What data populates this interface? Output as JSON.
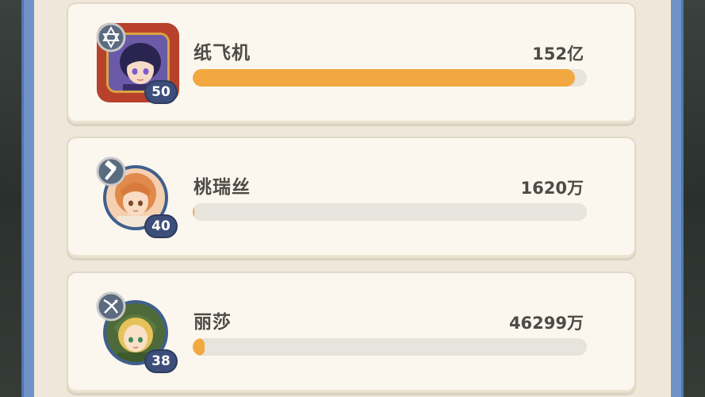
{
  "ranking": [
    {
      "name": "纸飞机",
      "value": "152亿",
      "level": "50",
      "progress": 0.97,
      "class_icon": "star-of-david-icon",
      "colors": {
        "hair": "#2a2550",
        "skin": "#f6dcc8",
        "bg": "#6a5aa8"
      }
    },
    {
      "name": "桃瑞丝",
      "value": "1620万",
      "level": "40",
      "progress": 0.004,
      "class_icon": "hammer-icon",
      "colors": {
        "hair": "#e08a4c",
        "skin": "#f8dcc4",
        "bg": "#f5d0b0"
      }
    },
    {
      "name": "丽莎",
      "value": "46299万",
      "level": "38",
      "progress": 0.03,
      "class_icon": "crossbow-icon",
      "colors": {
        "hair": "#e7c25a",
        "skin": "#f8e1c8",
        "bg": "#4f6a3a"
      }
    }
  ],
  "colors": {
    "bar_fill": "#f2a840",
    "bar_track": "#e7e3dd",
    "frame_blue": "#6f93c9",
    "card_bg": "#fbf7ef"
  }
}
